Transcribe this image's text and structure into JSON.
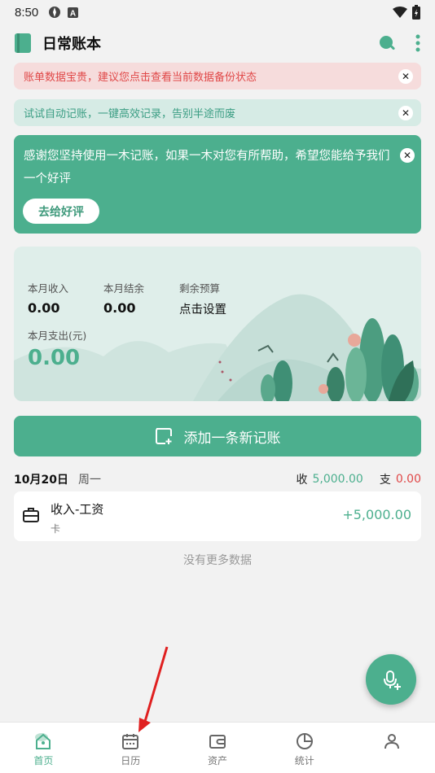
{
  "status_bar": {
    "time": "8:50"
  },
  "app": {
    "title": "日常账本"
  },
  "banners": {
    "backup": "账单数据宝贵，建议您点击查看当前数据备份状态",
    "auto": "试试自动记账，一键高效记录，告别半途而废"
  },
  "promo": {
    "text": "感谢您坚持使用一木记账，如果一木对您有所帮助，希望您能给予我们一个好评",
    "button": "去给好评"
  },
  "summary": {
    "income_label": "本月收入",
    "income_value": "0.00",
    "balance_label": "本月结余",
    "balance_value": "0.00",
    "budget_label": "剩余预算",
    "budget_value": "点击设置",
    "expense_label": "本月支出(元)",
    "expense_value": "0.00"
  },
  "add_button": {
    "label": "添加一条新记账"
  },
  "day": {
    "date": "10月20日",
    "weekday": "周一",
    "income_label": "收",
    "income_value": "5,000.00",
    "expense_label": "支",
    "expense_value": "0.00"
  },
  "records": [
    {
      "title": "收入-工资",
      "account": "卡",
      "amount": "+5,000.00",
      "icon": "briefcase-icon"
    }
  ],
  "no_more": "没有更多数据",
  "nav": [
    {
      "label": "首页",
      "icon": "home-icon",
      "active": true
    },
    {
      "label": "日历",
      "icon": "calendar-icon",
      "active": false
    },
    {
      "label": "资产",
      "icon": "wallet-icon",
      "active": false
    },
    {
      "label": "统计",
      "icon": "chart-icon",
      "active": false
    },
    {
      "label": "",
      "icon": "user-icon",
      "active": false
    }
  ],
  "colors": {
    "accent": "#4caf8e",
    "danger": "#e04848",
    "background": "#f2f2f2"
  }
}
